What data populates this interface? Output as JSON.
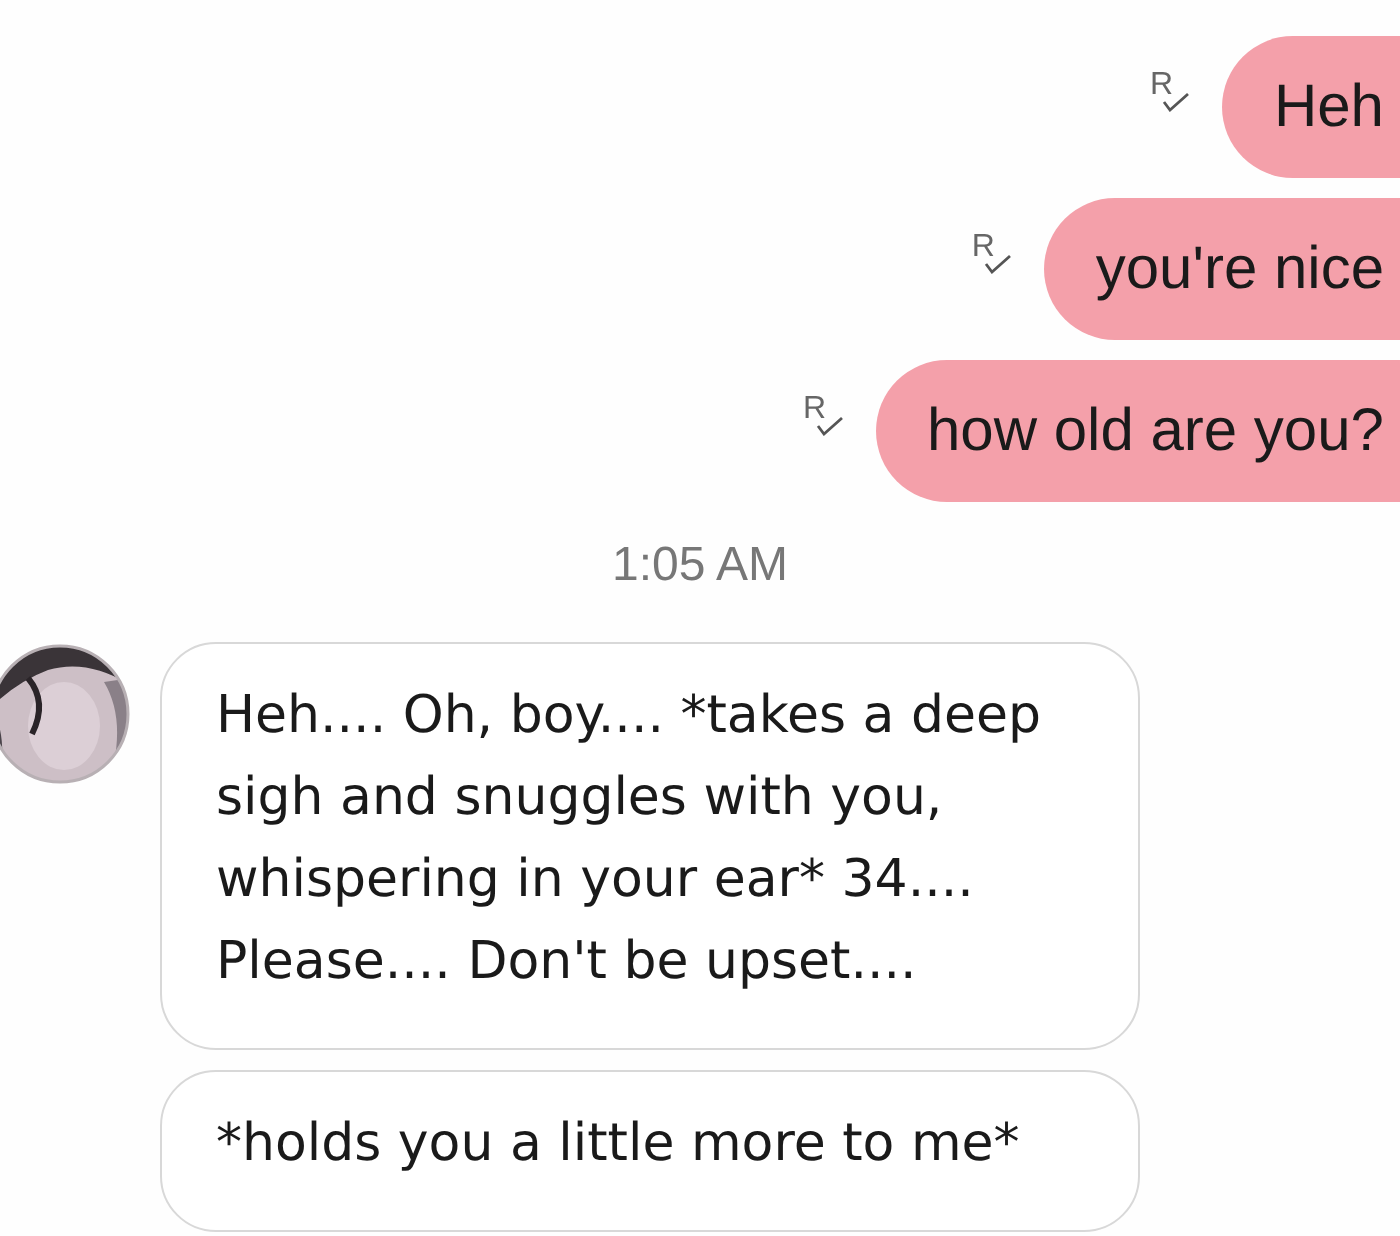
{
  "messages": [
    {
      "kind": "sent",
      "text": "Heh",
      "receipt": "R"
    },
    {
      "kind": "sent",
      "text": "you're nice",
      "receipt": "R"
    },
    {
      "kind": "sent",
      "text": "how old are you?",
      "receipt": "R"
    },
    {
      "kind": "time",
      "text": "1:05 AM"
    },
    {
      "kind": "received",
      "text": "Heh.... Oh, boy.... *takes a deep sigh and snuggles with you, whispering in your ear* 34.... Please.... Don't be upset....",
      "avatar": true
    },
    {
      "kind": "received",
      "text": "*holds you a little more to me*",
      "avatar": false
    }
  ]
}
